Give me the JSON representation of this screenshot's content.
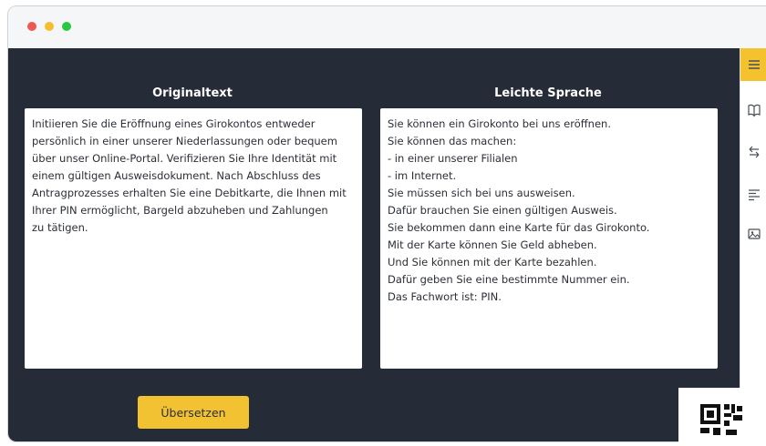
{
  "window": {
    "controls": [
      "close",
      "minimize",
      "maximize"
    ]
  },
  "panels": {
    "original": {
      "title": "Originaltext",
      "text": "Initiieren Sie die Eröffnung eines Girokontos entweder\npersönlich in einer unserer Niederlassungen oder bequem\nüber unser Online-Portal. Verifizieren Sie Ihre Identität mit\neinem gültigen Ausweisdokument. Nach Abschluss des\nAntragprozesses erhalten Sie eine Debitkarte, die Ihnen mit\nIhrer PIN ermöglicht, Bargeld abzuheben und Zahlungen\nzu tätigen."
    },
    "simple": {
      "title": "Leichte Sprache",
      "text": "Sie können ein Girokonto bei uns eröffnen.\nSie können das machen:\n- in einer unserer Filialen\n- im Internet.\nSie müssen sich bei uns ausweisen.\nDafür brauchen Sie einen gültigen Ausweis.\nSie bekommen dann eine Karte für das Girokonto.\nMit der Karte können Sie Geld abheben.\nUnd Sie können mit der Karte bezahlen.\nDafür geben Sie eine bestimmte Nummer ein.\nDas Fachwort ist: PIN."
    }
  },
  "actions": {
    "translate_label": "Übersetzen"
  },
  "sidebar": {
    "items": [
      {
        "icon": "menu-icon",
        "active": true
      },
      {
        "icon": "book-icon",
        "active": false
      },
      {
        "icon": "swap-arrows-icon",
        "active": false
      },
      {
        "icon": "text-align-icon",
        "active": false
      },
      {
        "icon": "image-icon",
        "active": false
      }
    ]
  },
  "colors": {
    "accent": "#f2c232",
    "panel_bg": "#252b37",
    "close": "#ee5a52",
    "minimize": "#f5bd2f",
    "maximize": "#28c840"
  }
}
